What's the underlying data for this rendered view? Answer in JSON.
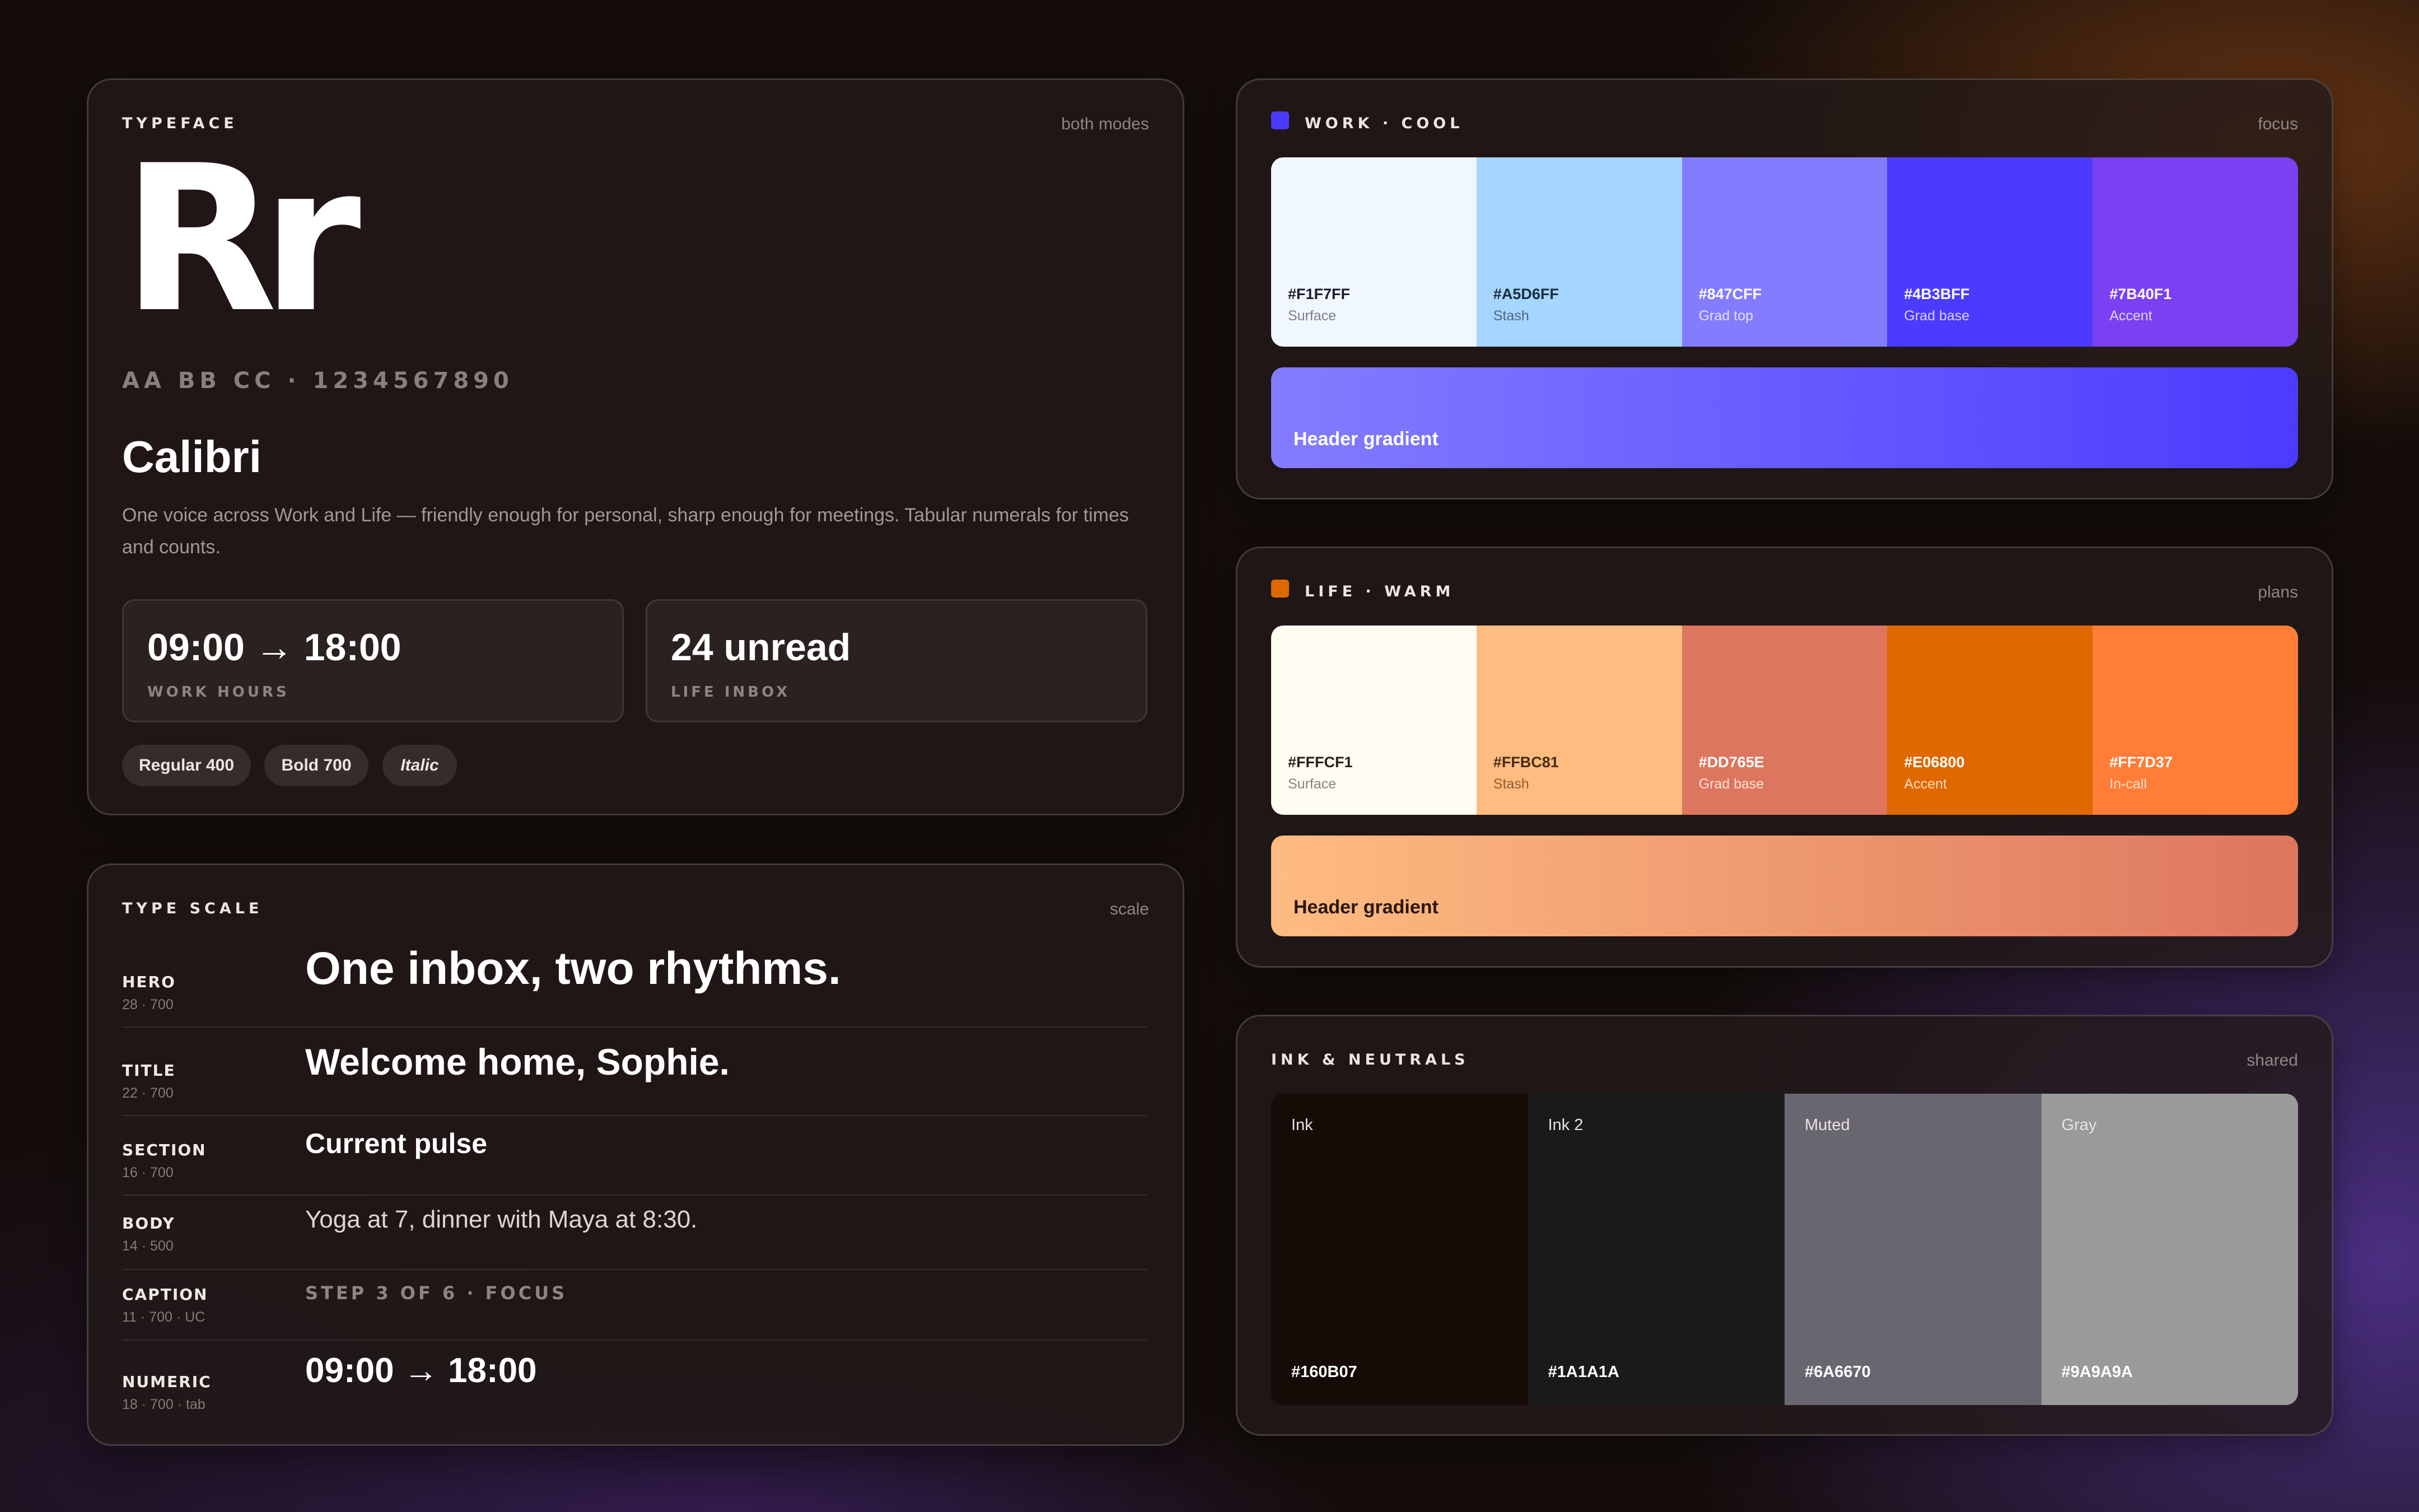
{
  "typeface": {
    "eyebrow": "TYPEFACE",
    "meta": "both modes",
    "specimen": "Rr",
    "charset": "AA BB CC · 1234567890",
    "name": "Calibri",
    "description": "One voice across Work and Life — friendly enough for personal, sharp enough for meetings. Tabular numerals for times and counts.",
    "stats": [
      {
        "value": "09:00 → 18:00",
        "label": "WORK HOURS"
      },
      {
        "value": "24 unread",
        "label": "LIFE INBOX"
      }
    ],
    "weights": [
      "Regular 400",
      "Bold 700",
      "Italic"
    ]
  },
  "type_scale": {
    "eyebrow": "TYPE SCALE",
    "meta": "scale",
    "rows": [
      {
        "label": "HERO",
        "spec": "28 · 700",
        "sample": "One inbox, two rhythms."
      },
      {
        "label": "TITLE",
        "spec": "22 · 700",
        "sample": "Welcome home, Sophie."
      },
      {
        "label": "SECTION",
        "spec": "16 · 700",
        "sample": "Current pulse"
      },
      {
        "label": "BODY",
        "spec": "14 · 500",
        "sample": "Yoga at 7, dinner with Maya at 8:30."
      },
      {
        "label": "CAPTION",
        "spec": "11 · 700 · UC",
        "sample": "STEP 3 OF 6 · FOCUS"
      },
      {
        "label": "NUMERIC",
        "spec": "18 · 700 · tab",
        "sample": "09:00 → 18:00"
      }
    ]
  },
  "work": {
    "eyebrow": "WORK · COOL",
    "meta": "focus",
    "dot_color": "#4B3BFF",
    "swatches": [
      {
        "hex": "#F1F7FF",
        "name": "Surface"
      },
      {
        "hex": "#A5D6FF",
        "name": "Stash"
      },
      {
        "hex": "#847CFF",
        "name": "Grad top"
      },
      {
        "hex": "#4B3BFF",
        "name": "Grad base"
      },
      {
        "hex": "#7B40F1",
        "name": "Accent"
      }
    ],
    "gradient_label": "Header gradient"
  },
  "life": {
    "eyebrow": "LIFE · WARM",
    "meta": "plans",
    "dot_color": "#E06800",
    "swatches": [
      {
        "hex": "#FFFCF1",
        "name": "Surface"
      },
      {
        "hex": "#FFBC81",
        "name": "Stash"
      },
      {
        "hex": "#DD765E",
        "name": "Grad base"
      },
      {
        "hex": "#E06800",
        "name": "Accent"
      },
      {
        "hex": "#FF7D37",
        "name": "In-call"
      }
    ],
    "gradient_label": "Header gradient"
  },
  "neutrals": {
    "eyebrow": "INK & NEUTRALS",
    "meta": "shared",
    "swatches": [
      {
        "name": "Ink",
        "hex": "#160B07"
      },
      {
        "name": "Ink 2",
        "hex": "#1A1A1A"
      },
      {
        "name": "Muted",
        "hex": "#6A6670"
      },
      {
        "name": "Gray",
        "hex": "#9A9A9A"
      }
    ]
  }
}
